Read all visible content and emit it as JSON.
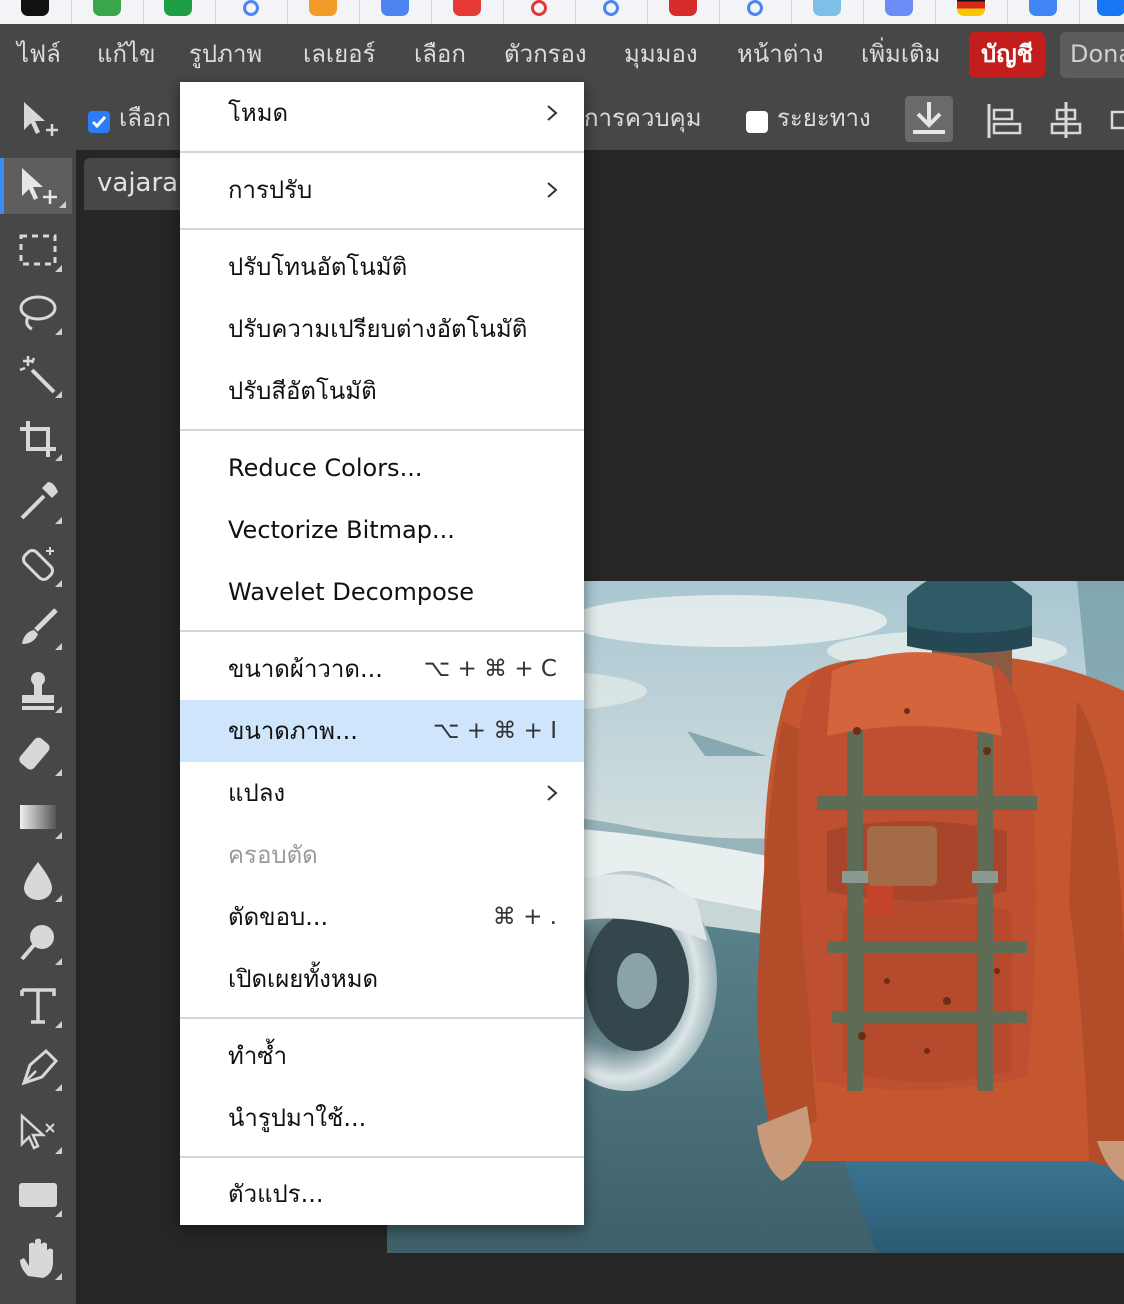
{
  "menubar": {
    "items": [
      "ไฟล์",
      "แก้ไข",
      "รูปภาพ",
      "เลเยอร์",
      "เลือก",
      "ตัวกรอง",
      "มุมมอง",
      "หน้าต่าง",
      "เพิ่มเติม"
    ],
    "account_label": "บัญชี",
    "donate_label": "Dona"
  },
  "options": {
    "auto_select_label": "เลือก",
    "controls_label": "การควบคุม",
    "distance_label": "ระยะทาง",
    "auto_select_checked": true,
    "distance_checked": false
  },
  "document": {
    "tab_label": "vajarai"
  },
  "tools": [
    "move-tool",
    "marquee-tool",
    "lasso-tool",
    "magic-wand-tool",
    "crop-tool",
    "eyedropper-tool",
    "healing-brush-tool",
    "brush-tool",
    "clone-stamp-tool",
    "eraser-tool",
    "gradient-tool",
    "blur-tool",
    "dodge-tool",
    "type-tool",
    "pen-tool",
    "path-select-tool",
    "shape-tool",
    "hand-tool"
  ],
  "image_menu": {
    "mode": "โหมด",
    "adjustments": "การปรับ",
    "auto_tone": "ปรับโทนอัตโนมัติ",
    "auto_contrast": "ปรับความเปรียบต่างอัตโนมัติ",
    "auto_color": "ปรับสีอัตโนมัติ",
    "reduce_colors": "Reduce Colors...",
    "vectorize_bitmap": "Vectorize Bitmap...",
    "wavelet_decompose": "Wavelet Decompose",
    "canvas_size": "ขนาดผ้าวาด...",
    "canvas_size_shortcut": "⌥ + ⌘ + C",
    "image_size": "ขนาดภาพ...",
    "image_size_shortcut": "⌥ + ⌘ + I",
    "transform": "แปลง",
    "crop": "ครอบตัด",
    "trim": "ตัดขอบ...",
    "trim_shortcut": "⌘ + .",
    "reveal_all": "เปิดเผยทั้งหมด",
    "duplicate": "ทำซ้ำ",
    "apply_image": "นำรูปมาใช้...",
    "variables": "ตัวแปร..."
  }
}
